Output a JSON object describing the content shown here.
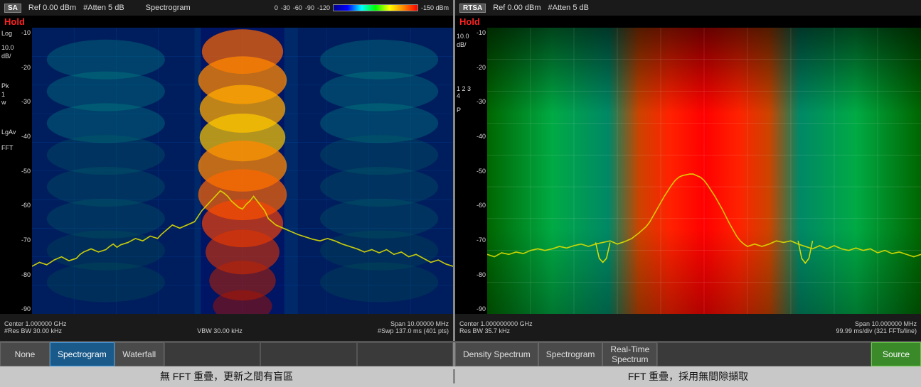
{
  "left_panel": {
    "header": {
      "badge": "SA",
      "ref": "Ref 0.00 dBm",
      "atten": "#Atten 5 dB",
      "title": "Spectrogram",
      "hold": "Hold",
      "scale_labels": [
        "0",
        "-30",
        "-60",
        "-90",
        "-120",
        "-150 dBm"
      ]
    },
    "side_labels": [
      "Log",
      "",
      "10.0",
      "dB/",
      "",
      "",
      "",
      "",
      "Pk",
      "1",
      "w",
      "",
      "",
      "",
      "LgAv"
    ],
    "y_axis": [
      "-10",
      "-20",
      "-30",
      "-40",
      "-50",
      "-60",
      "-70",
      "-80",
      "-90"
    ],
    "footer": {
      "line1_left": "Center 1.000000 GHz",
      "line1_right": "Span 10.00000 MHz",
      "line2_left": "#Res BW 30.00 kHz",
      "line2_mid": "VBW 30.00 kHz",
      "line2_right": "#Swp 137.0 ms (401 pts)"
    },
    "type_label": "FFT"
  },
  "right_panel": {
    "header": {
      "badge": "RTSA",
      "ref": "Ref 0.00 dBm",
      "atten": "#Atten 5 dB",
      "hold": "Hold"
    },
    "side_labels": [
      "10.0",
      "dB/",
      "",
      "",
      "1 2 3 4",
      "",
      "P"
    ],
    "y_axis": [
      "-10",
      "-20",
      "-30",
      "-40",
      "-50",
      "-60",
      "-70",
      "-80",
      "-90"
    ],
    "footer": {
      "line1_left": "Center 1.000000000 GHz",
      "line1_right": "Span 10.000000 MHz",
      "line2_left": "Res BW 35.7 kHz",
      "line2_right": "99.99 ms/div (321 FFTs/line)"
    }
  },
  "left_buttons": [
    {
      "label": "None",
      "active": false,
      "style": "normal"
    },
    {
      "label": "Spectrogram",
      "active": true,
      "style": "blue"
    },
    {
      "label": "Waterfall",
      "active": false,
      "style": "normal"
    },
    {
      "label": "",
      "active": false,
      "style": "spacer"
    },
    {
      "label": "",
      "active": false,
      "style": "spacer"
    },
    {
      "label": "",
      "active": false,
      "style": "spacer"
    }
  ],
  "right_buttons": [
    {
      "label": "Density Spectrum",
      "active": false,
      "style": "normal"
    },
    {
      "label": "Spectrogram",
      "active": false,
      "style": "normal"
    },
    {
      "label": "Real-Time\nSpectrum",
      "active": false,
      "style": "normal"
    },
    {
      "label": "",
      "active": false,
      "style": "spacer"
    },
    {
      "label": "Source",
      "active": true,
      "style": "green"
    }
  ],
  "captions": {
    "left": "無 FFT 重疊，更新之間有盲區",
    "right": "FFT 重疊，採用無間隙擷取"
  }
}
